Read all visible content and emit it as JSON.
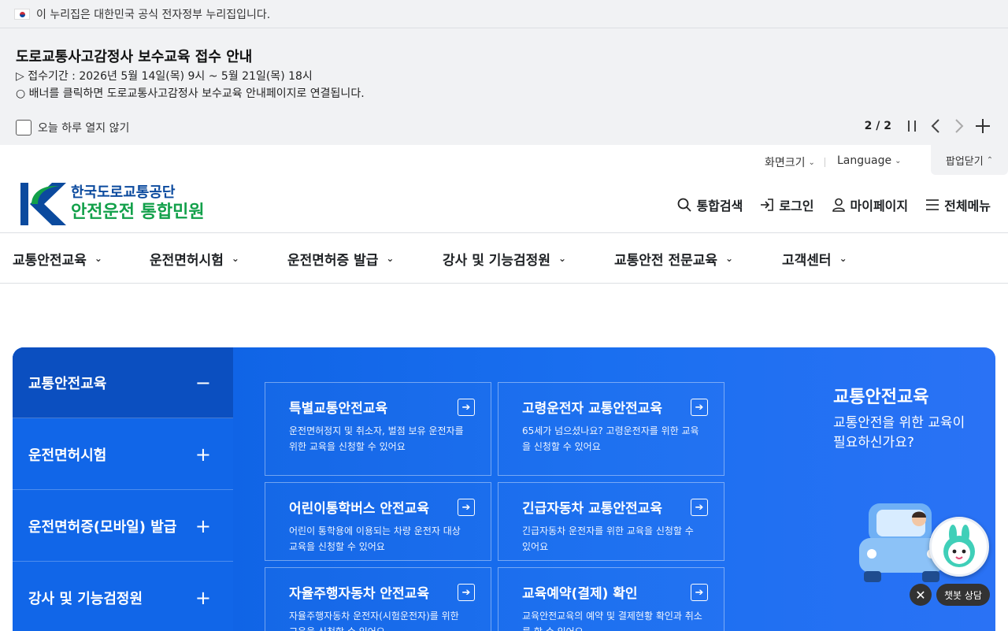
{
  "gov_bar": {
    "text": "이 누리집은 대한민국 공식 전자정부 누리집입니다."
  },
  "banner": {
    "title": "도로교통사고감정사 보수교육 접수 안내",
    "line1": "▷ 접수기간 : 2026년 5월 14일(목) 9시 ~ 5월 21일(목) 18시",
    "line2": "○ 배너를 클릭하면 도로교통사고감정사 보수교육 안내페이지로 연결됩니다.",
    "dont_show_label": "오늘 하루 열지 않기",
    "pager": "2 / 2"
  },
  "utility": {
    "screen_size": "화면크기",
    "language": "Language",
    "popup_close": "팝업닫기"
  },
  "logo": {
    "org": "한국도로교통공단",
    "service": "안전운전 통합민원"
  },
  "header_actions": [
    {
      "label": "통합검색"
    },
    {
      "label": "로그인"
    },
    {
      "label": "마이페이지"
    },
    {
      "label": "전체메뉴"
    }
  ],
  "gnb": [
    {
      "label": "교통안전교육"
    },
    {
      "label": "운전면허시험"
    },
    {
      "label": "운전면허증 발급"
    },
    {
      "label": "강사 및 기능검정원"
    },
    {
      "label": "교통안전 전문교육"
    },
    {
      "label": "고객센터"
    }
  ],
  "side_menu": [
    {
      "label": "교통안전교육",
      "sign": "−"
    },
    {
      "label": "운전면허시험",
      "sign": "+"
    },
    {
      "label": "운전면허증(모바일) 발급",
      "sign": "+"
    },
    {
      "label": "강사 및 기능검정원",
      "sign": "+"
    }
  ],
  "cards": [
    {
      "title": "특별교통안전교육",
      "desc": "운전면허정지 및 취소자, 벌점 보유 운전자를 위한 교육을 신청할 수 있어요"
    },
    {
      "title": "고령운전자 교통안전교육",
      "desc": "65세가 넘으셨나요? 고령운전자를 위한 교육을 신청할 수 있어요"
    },
    {
      "title": "어린이통학버스 안전교육",
      "desc": "어린이 통학용에 이용되는 차량 운전자 대상 교육을 신청할 수 있어요"
    },
    {
      "title": "긴급자동차 교통안전교육",
      "desc": "긴급자동차 운전자를 위한 교육을 신청할 수 있어요"
    },
    {
      "title": "자율주행자동차 안전교육",
      "desc": "자율주행자동차 운전자(시험운전자)를 위한 교육을 신청할 수 있어요"
    },
    {
      "title": "교육예약(결제) 확인",
      "desc": "교육안전교육의 예약 및 결제현황 확인과 취소를 할 수 있어요"
    }
  ],
  "promo": {
    "title": "교통안전교육",
    "desc": "교통안전을 위한 교육이 필요하신가요?"
  },
  "chatbot": {
    "label": "챗봇 상담"
  },
  "colors": {
    "primary": "#1166e8",
    "logo_blue": "#0b4a9e",
    "logo_green": "#12a04a"
  }
}
